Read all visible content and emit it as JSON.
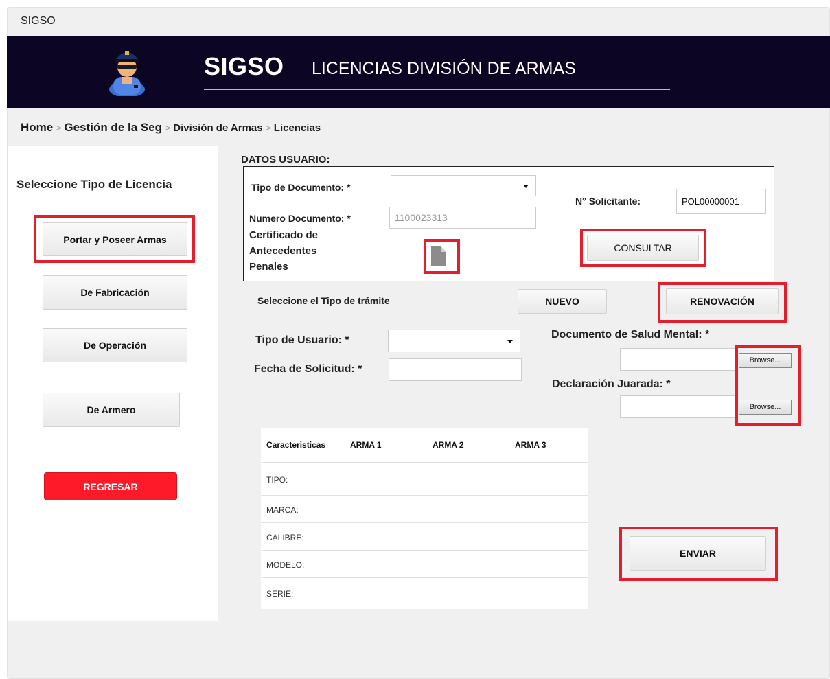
{
  "app": {
    "window_title": "SIGSO"
  },
  "header": {
    "brand": "SIGSO",
    "subtitle": "LICENCIAS DIVISIÓN DE ARMAS"
  },
  "breadcrumb": {
    "items": [
      "Home",
      "Gestión de la Seg",
      "División de Armas",
      "Licencias"
    ],
    "separator": ">"
  },
  "sidebar": {
    "title": "Seleccione Tipo de Licencia",
    "buttons": [
      "Portar y Poseer Armas",
      "De Fabricación",
      "De Operación",
      "De Armero"
    ],
    "back_label": "REGRESAR"
  },
  "user_data": {
    "section_title": "DATOS USUARIO:",
    "tipo_documento_label": "Tipo de Documento: *",
    "tipo_documento_value": "",
    "numero_documento_label": "Numero Documento: *",
    "numero_documento_value": "1100023313",
    "certificado_label_1": "Certificado de",
    "certificado_label_2": "Antecedentes",
    "certificado_label_3": "Penales",
    "solicitante_label": "N° Solicitante:",
    "solicitante_value": "POL00000001",
    "consultar_label": "CONSULTAR"
  },
  "tramite": {
    "label": "Seleccione el Tipo de trámite",
    "nuevo_label": "NUEVO",
    "renovacion_label": "RENOVACIÓN"
  },
  "form": {
    "tipo_usuario_label": "Tipo de Usuario: *",
    "fecha_solicitud_label": "Fecha de Solicitud: *",
    "salud_mental_label": "Documento de Salud Mental: *",
    "declaracion_label": "Declaración Juarada: *",
    "browse_label": "Browse..."
  },
  "weapons_table": {
    "headers": [
      "Caracteristicas",
      "ARMA 1",
      "ARMA 2",
      "ARMA 3"
    ],
    "rows": [
      "TIPO:",
      "MARCA:",
      "CALIBRE:",
      "MODELO:",
      "SERIE:"
    ]
  },
  "enviar_label": "ENVIAR",
  "colors": {
    "header_bg": "#0c0524",
    "highlight": "#e31e2d",
    "back_button": "#ff1a2a"
  },
  "icons": [
    "police-avatar-icon",
    "document-icon",
    "caret-down-icon"
  ]
}
